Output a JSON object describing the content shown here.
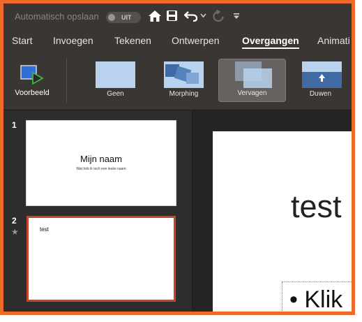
{
  "titlebar": {
    "autosave_label": "Automatisch opslaan",
    "autosave_state": "UIT",
    "icons": [
      "home-icon",
      "save-icon",
      "undo-icon",
      "chevron-down-icon",
      "redo-icon",
      "customize-toolbar-icon"
    ]
  },
  "ribbon_tabs": {
    "start": "Start",
    "insert": "Invoegen",
    "draw": "Tekenen",
    "design": "Ontwerpen",
    "transitions": "Overgangen",
    "animations": "Animati"
  },
  "ribbon": {
    "preview_label": "Voorbeeld",
    "transitions": {
      "none": "Geen",
      "morph": "Morphing",
      "fade": "Vervagen",
      "push": "Duwen"
    }
  },
  "thumbnails": {
    "slide1": {
      "number": "1",
      "title": "Mijn naam",
      "subtitle": "Wat heb ik toch een leuke naam"
    },
    "slide2": {
      "number": "2",
      "title": "test",
      "star": "★"
    }
  },
  "editor": {
    "slide_title": "test",
    "bullet": "•",
    "bullet_text": "Klik"
  },
  "colors": {
    "frame_accent": "#ee6a2a",
    "selected_thumb_border": "#c8452c",
    "app_bg": "#2b2a29"
  }
}
